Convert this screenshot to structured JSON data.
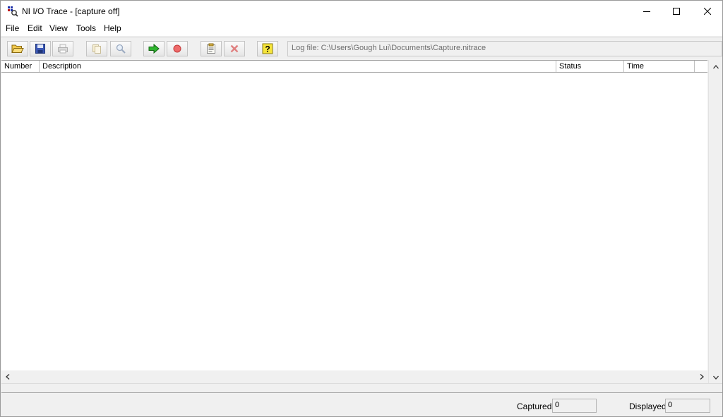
{
  "window": {
    "title": "NI I/O Trace - [capture off]",
    "icon": "ni-io-trace-icon"
  },
  "menu": [
    "File",
    "Edit",
    "View",
    "Tools",
    "Help"
  ],
  "toolbar": {
    "buttons": [
      {
        "icon": "open-folder-icon",
        "enabled": true
      },
      {
        "icon": "save-disk-icon",
        "enabled": true
      },
      {
        "icon": "print-icon",
        "enabled": false
      },
      {
        "icon": "copy-icon",
        "enabled": false
      },
      {
        "icon": "find-icon",
        "enabled": false
      },
      {
        "icon": "start-capture-icon",
        "enabled": true
      },
      {
        "icon": "stop-capture-icon",
        "enabled": true
      },
      {
        "icon": "properties-icon",
        "enabled": true
      },
      {
        "icon": "clear-icon",
        "enabled": true
      },
      {
        "icon": "help-icon",
        "enabled": true
      }
    ],
    "log_file": "Log file: C:\\Users\\Gough Lui\\Documents\\Capture.nitrace"
  },
  "list": {
    "columns": [
      "Number",
      "Description",
      "Status",
      "Time"
    ],
    "rows": []
  },
  "status": {
    "captured_label": "Captured",
    "captured_value": "0",
    "displayed_label": "Displayed",
    "displayed_value": "0"
  }
}
